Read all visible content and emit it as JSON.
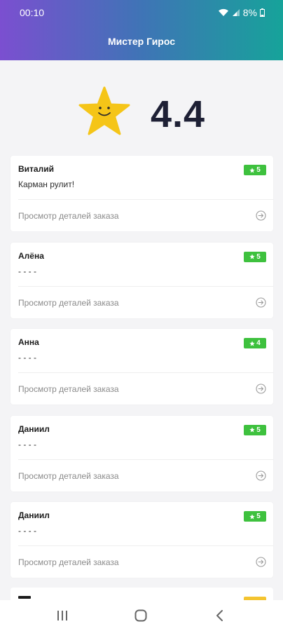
{
  "status_bar": {
    "time": "00:10",
    "battery": "8%"
  },
  "header": {
    "title": "Мистер Гирос"
  },
  "rating": {
    "value": "4.4",
    "icon": "smiling-star-icon",
    "star_color": "#f5c518"
  },
  "colors": {
    "badge_green": "#3ec13e",
    "badge_yellow": "#f4c430",
    "rating_text": "#1e2035"
  },
  "reviews": [
    {
      "name": "Виталий",
      "score": "5",
      "comment": "Карман рулит!",
      "link": "Просмотр деталей заказа"
    },
    {
      "name": "Алёна",
      "score": "5",
      "comment": "- - - -",
      "link": "Просмотр деталей заказа"
    },
    {
      "name": "Анна",
      "score": "4",
      "comment": "- - - -",
      "link": "Просмотр деталей заказа"
    },
    {
      "name": "Даниил",
      "score": "5",
      "comment": "- - - -",
      "link": "Просмотр деталей заказа"
    },
    {
      "name": "Даниил",
      "score": "5",
      "comment": "- - - -",
      "link": "Просмотр деталей заказа"
    }
  ],
  "nav": {
    "recents_icon": "recents-icon",
    "home_icon": "home-icon",
    "back_icon": "back-icon"
  }
}
